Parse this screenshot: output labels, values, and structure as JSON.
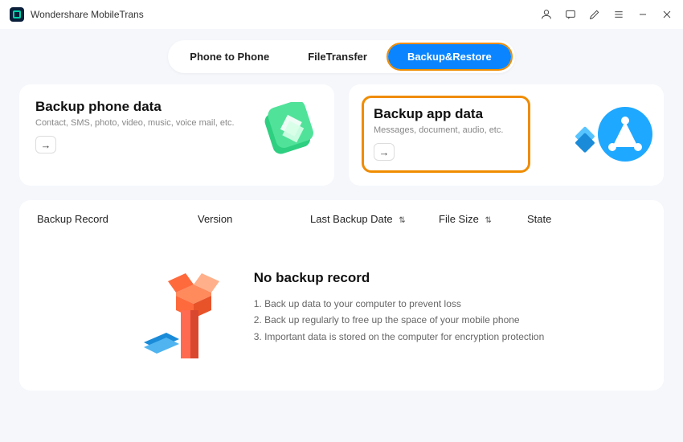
{
  "app": {
    "title": "Wondershare MobileTrans"
  },
  "tabs": {
    "phone": "Phone to Phone",
    "file": "FileTransfer",
    "backup": "Backup&Restore"
  },
  "cards": {
    "phone": {
      "title": "Backup phone data",
      "sub": "Contact, SMS, photo, video, music, voice mail, etc."
    },
    "app": {
      "title": "Backup app data",
      "sub": "Messages, document, audio, etc."
    }
  },
  "table": {
    "headers": {
      "record": "Backup Record",
      "version": "Version",
      "date": "Last Backup Date",
      "size": "File Size",
      "state": "State"
    }
  },
  "empty": {
    "title": "No backup record",
    "line1": "1. Back up data to your computer to prevent loss",
    "line2": "2. Back up regularly to free up the space of your mobile phone",
    "line3": "3. Important data is stored on the computer for encryption protection"
  }
}
